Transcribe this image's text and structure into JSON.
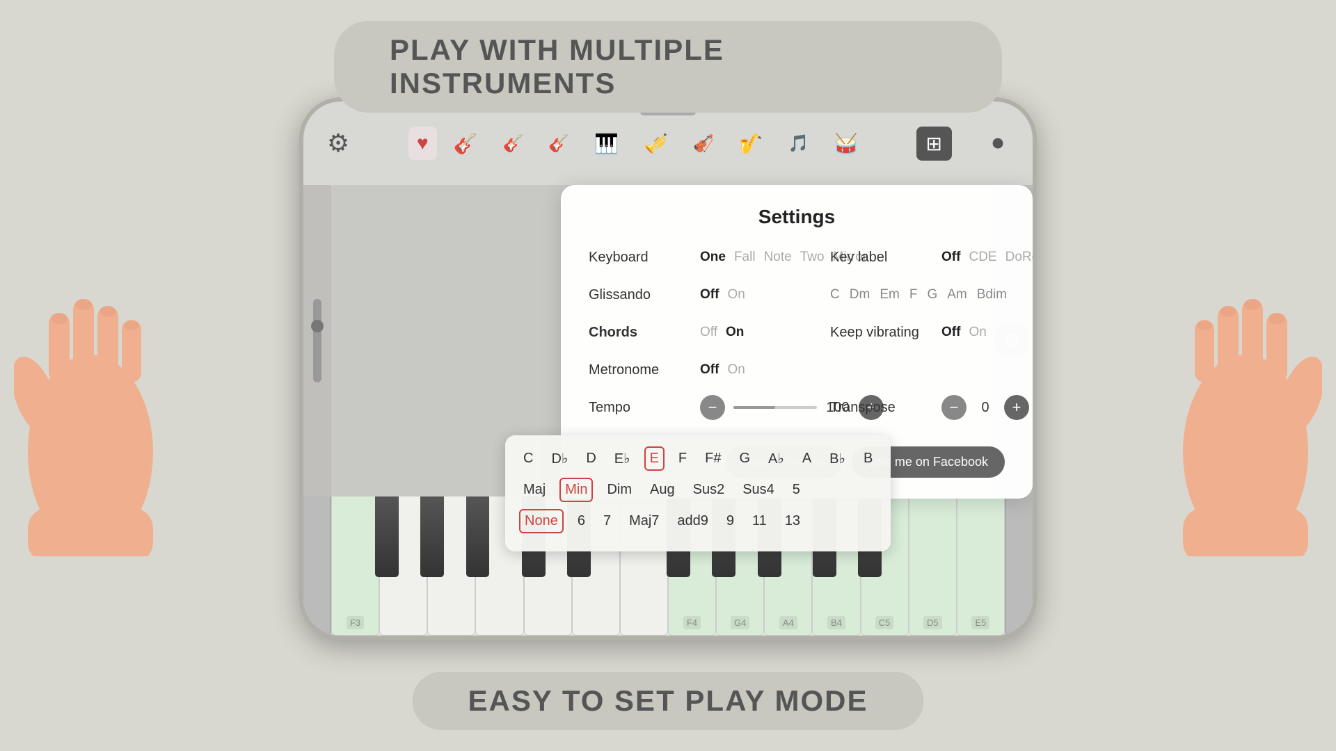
{
  "top_banner": {
    "text": "PLAY WITH MULTIPLE INSTRUMENTS"
  },
  "bottom_banner": {
    "text": "EASY TO SET PLAY MODE"
  },
  "settings": {
    "title": "Settings",
    "keyboard": {
      "label": "Keyboard",
      "options": [
        "One",
        "Fall",
        "Note",
        "Two",
        "Mirror"
      ],
      "active": "One"
    },
    "glissando": {
      "label": "Glissando",
      "options": [
        "Off",
        "On"
      ],
      "active": "Off"
    },
    "key_label": {
      "label": "Key label",
      "options": [
        "Off",
        "CDE",
        "DoReMi"
      ],
      "active": "Off"
    },
    "chords": {
      "label": "Chords",
      "options": [
        "Off",
        "On"
      ],
      "active": "On",
      "notes": [
        "C",
        "Dm",
        "Em",
        "F",
        "G",
        "Am",
        "Bdim"
      ]
    },
    "metronome": {
      "label": "Metronome",
      "options": [
        "Off",
        "On"
      ],
      "active": "Off"
    },
    "keep_vibrating": {
      "label": "Keep vibrating",
      "options": [
        "Off",
        "On"
      ],
      "active": "Off"
    },
    "tempo": {
      "label": "Tempo",
      "value": "100",
      "minus": "−",
      "plus": "+"
    },
    "transpose": {
      "label": "Transpose",
      "value": "0",
      "minus": "−",
      "plus": "+"
    }
  },
  "chord_popup": {
    "row1": [
      "C",
      "D♭",
      "D",
      "E♭",
      "E",
      "F",
      "F#",
      "G",
      "A♭",
      "A",
      "B♭",
      "B"
    ],
    "row2": [
      "Maj",
      "Min",
      "Dim",
      "Aug",
      "Sus2",
      "Sus4",
      "5"
    ],
    "row3": [
      "None",
      "6",
      "7",
      "Maj7",
      "add9",
      "9",
      "11",
      "13"
    ],
    "selected_note": "E",
    "selected_quality": "Min",
    "selected_extension": "None"
  },
  "buttons": {
    "rate_review": "Rate & Review",
    "facebook": "Join me on Facebook"
  },
  "toolbar": {
    "instruments": [
      "♥",
      "🎸",
      "🎸",
      "🎸",
      "🎹",
      "🎺",
      "🎸",
      "🎷",
      "🎵",
      "🥁"
    ],
    "piano_icon": "⊞"
  },
  "piano_keys": {
    "labeled_keys": [
      "F3",
      "F4",
      "G4",
      "A4",
      "B4",
      "C5",
      "D5",
      "E5"
    ],
    "green_keys": [
      "F3",
      "F4",
      "G4",
      "A4",
      "B4",
      "C5",
      "D5",
      "E5"
    ]
  }
}
